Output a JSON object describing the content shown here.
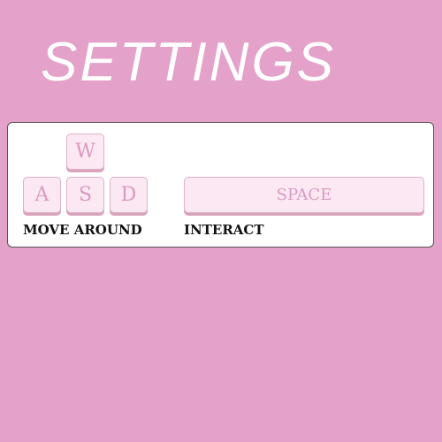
{
  "header": {
    "title": "SETTINGS"
  },
  "controls": {
    "movement": {
      "keys": {
        "up": "W",
        "left": "A",
        "down": "S",
        "right": "D"
      },
      "caption": "MOVE AROUND"
    },
    "interact": {
      "key": "SPACE",
      "caption": "INTERACT"
    }
  },
  "colors": {
    "background": "#e4a1c9",
    "panel": "#ffffff",
    "key_face": "#fce8f3",
    "key_text": "#d99ac0",
    "caption_text": "#111111",
    "title_text": "#ffffff"
  }
}
